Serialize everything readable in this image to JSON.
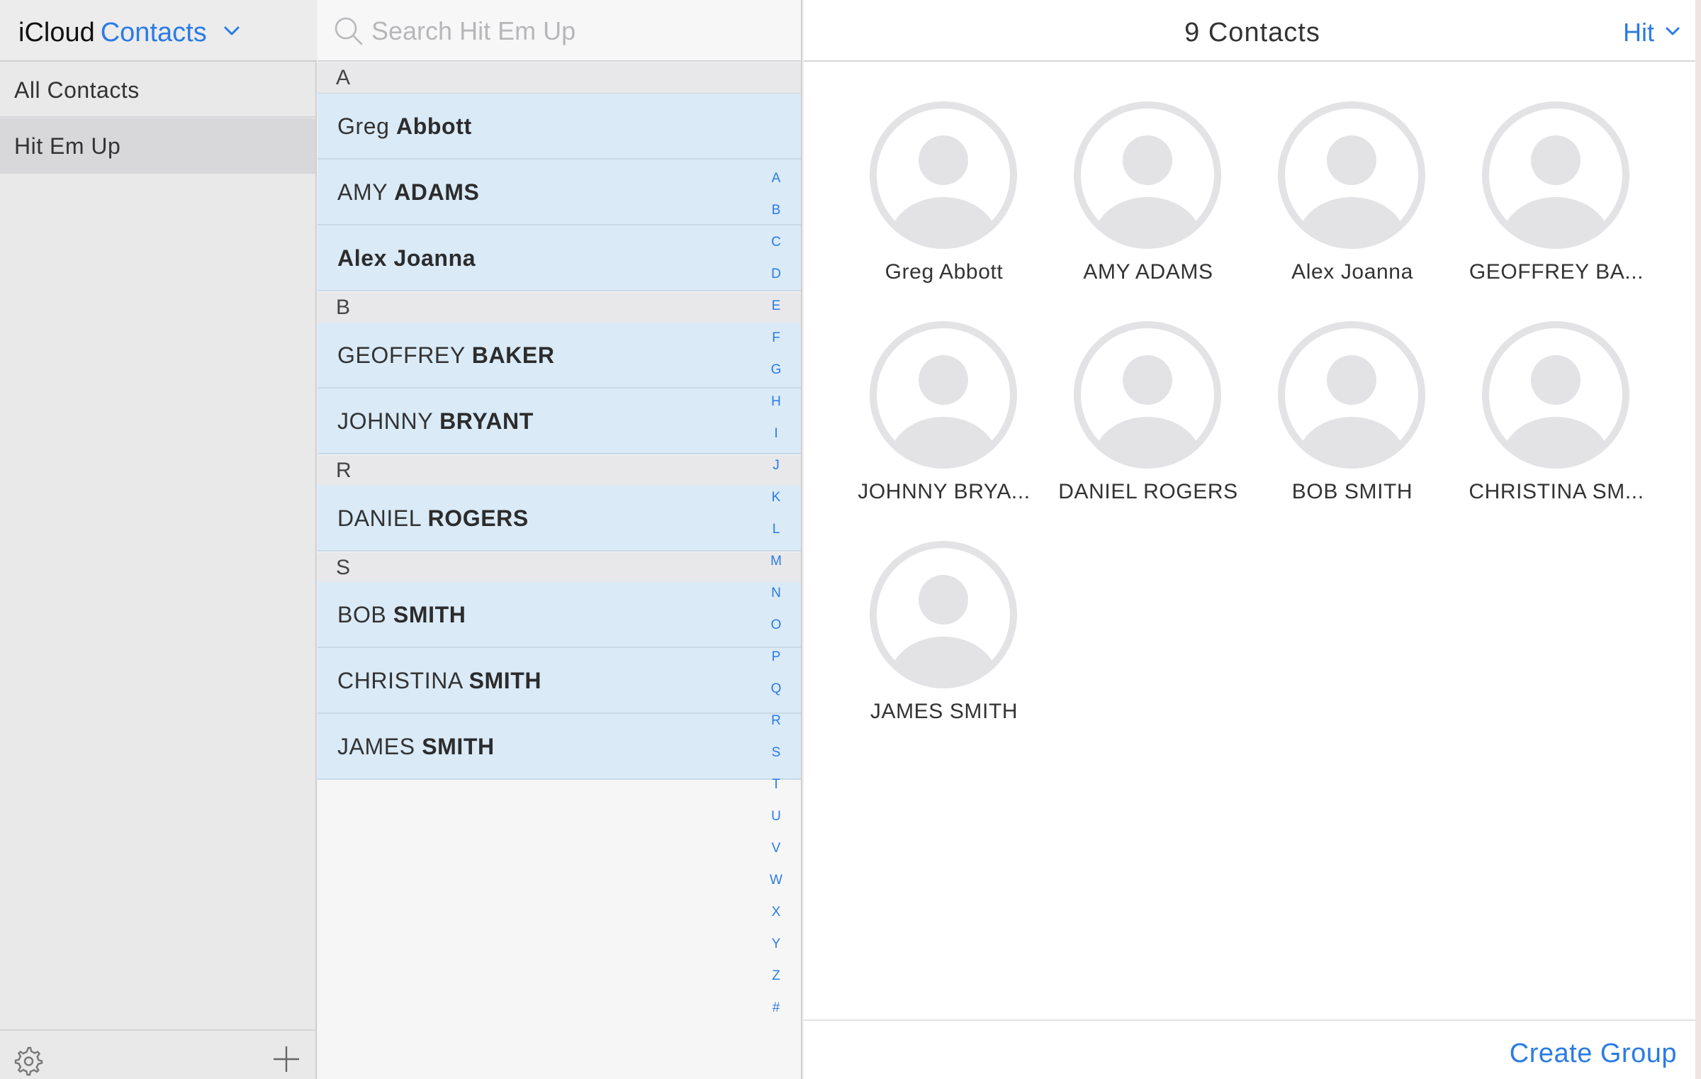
{
  "sidebar": {
    "brand_icloud": "iCloud",
    "brand_contacts": "Contacts",
    "groups": [
      {
        "label": "All Contacts"
      },
      {
        "label": "Hit Em Up"
      }
    ]
  },
  "search": {
    "placeholder": "Search Hit Em Up",
    "value": ""
  },
  "list": {
    "sections": [
      {
        "letter": "A",
        "contacts": [
          {
            "first": "Greg",
            "last": "Abbott"
          },
          {
            "first": "AMY",
            "last": "ADAMS"
          },
          {
            "first": "",
            "last": "Alex Joanna"
          }
        ]
      },
      {
        "letter": "B",
        "contacts": [
          {
            "first": "GEOFFREY",
            "last": "BAKER"
          },
          {
            "first": "JOHNNY",
            "last": "BRYANT"
          }
        ]
      },
      {
        "letter": "R",
        "contacts": [
          {
            "first": "DANIEL",
            "last": "ROGERS"
          }
        ]
      },
      {
        "letter": "S",
        "contacts": [
          {
            "first": "BOB",
            "last": "SMITH"
          },
          {
            "first": "CHRISTINA",
            "last": "SMITH"
          },
          {
            "first": "JAMES",
            "last": "SMITH"
          }
        ]
      }
    ],
    "alpha_index": [
      "A",
      "B",
      "C",
      "D",
      "E",
      "F",
      "G",
      "H",
      "I",
      "J",
      "K",
      "L",
      "M",
      "N",
      "O",
      "P",
      "Q",
      "R",
      "S",
      "T",
      "U",
      "V",
      "W",
      "X",
      "Y",
      "Z",
      "#"
    ]
  },
  "detail": {
    "count_label": "9 Contacts",
    "group_switch_label": "Hit",
    "cards": [
      {
        "name": "Greg Abbott"
      },
      {
        "name": "AMY ADAMS"
      },
      {
        "name": "Alex Joanna"
      },
      {
        "name": "GEOFFREY BA..."
      },
      {
        "name": "JOHNNY BRYA..."
      },
      {
        "name": "DANIEL ROGERS"
      },
      {
        "name": "BOB SMITH"
      },
      {
        "name": "CHRISTINA SM..."
      },
      {
        "name": "JAMES SMITH"
      }
    ],
    "create_group_label": "Create Group"
  },
  "colors": {
    "accent": "#2b7be4",
    "selected_row": "#daeaf7",
    "sidebar_bg": "#e9e9ea",
    "avatar": "#e3e3e5"
  }
}
